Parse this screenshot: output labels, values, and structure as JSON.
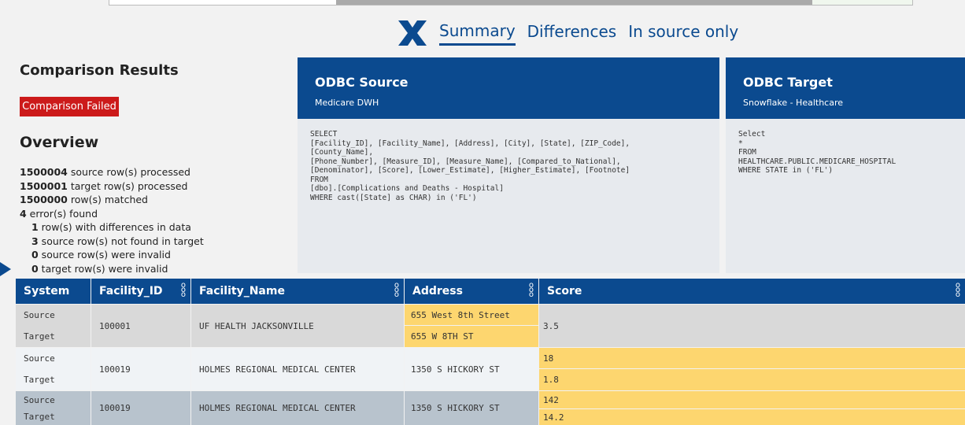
{
  "nav": {
    "tabs": [
      {
        "label": "Summary"
      },
      {
        "label": "Differences"
      },
      {
        "label": "In source only"
      }
    ]
  },
  "summary": {
    "title": "Comparison Results",
    "status": "Comparison Failed",
    "overview_title": "Overview",
    "stats": [
      {
        "value": "1500004",
        "text": " source row(s) processed"
      },
      {
        "value": "1500001",
        "text": " target row(s) processed"
      },
      {
        "value": "1500000",
        "text": " row(s) matched"
      },
      {
        "value": "4",
        "text": " error(s) found"
      },
      {
        "value": "1",
        "text": " row(s) with differences in data"
      },
      {
        "value": "3",
        "text": " source row(s) not found in target"
      },
      {
        "value": "0",
        "text": " source row(s) were invalid"
      },
      {
        "value": "0",
        "text": " target row(s) were invalid"
      }
    ]
  },
  "source": {
    "title": "ODBC Source",
    "subtitle": "Medicare DWH",
    "query": "SELECT\n[Facility_ID], [Facility_Name], [Address], [City], [State], [ZIP_Code],\n[County_Name],\n[Phone_Number], [Measure_ID], [Measure_Name], [Compared_to_National],\n[Denominator], [Score], [Lower_Estimate], [Higher_Estimate], [Footnote]\nFROM\n[dbo].[Complications and Deaths - Hospital]\nWHERE cast([State] as CHAR) in ('FL')"
  },
  "target": {
    "title": "ODBC Target",
    "subtitle": "Snowflake - Healthcare",
    "query": "Select\n*\nFROM\nHEALTHCARE.PUBLIC.MEDICARE_HOSPITAL\nWHERE STATE in ('FL')"
  },
  "grid": {
    "columns": [
      "System",
      "Facility_ID",
      "Facility_Name",
      "Address",
      "Score"
    ],
    "rows": [
      {
        "sys_src": "Source",
        "sys_tgt": "Target",
        "facility_id": "100001",
        "facility_name": "UF HEALTH JACKSONVILLE",
        "address_src": "655 West 8th Street",
        "address_tgt": "655 W 8TH ST",
        "score": "3.5"
      },
      {
        "sys_src": "Source",
        "sys_tgt": "Target",
        "facility_id": "100019",
        "facility_name": "HOLMES REGIONAL MEDICAL CENTER",
        "address": "1350 S HICKORY ST",
        "score_src": "18",
        "score_tgt": "1.8"
      },
      {
        "sys_src": "Source",
        "sys_tgt": "Target",
        "facility_id": "100019",
        "facility_name": "HOLMES REGIONAL MEDICAL CENTER",
        "address": "1350 S HICKORY ST",
        "score_src": "142",
        "score_tgt": "14.2"
      }
    ]
  },
  "colors": {
    "primary": "#0b4a8f",
    "failed": "#cc1a1a",
    "diff": "#fdd66f",
    "row_gray": "#d9d9d9",
    "row_light": "#f0f3f6",
    "row_slate": "#b8c3cd"
  }
}
